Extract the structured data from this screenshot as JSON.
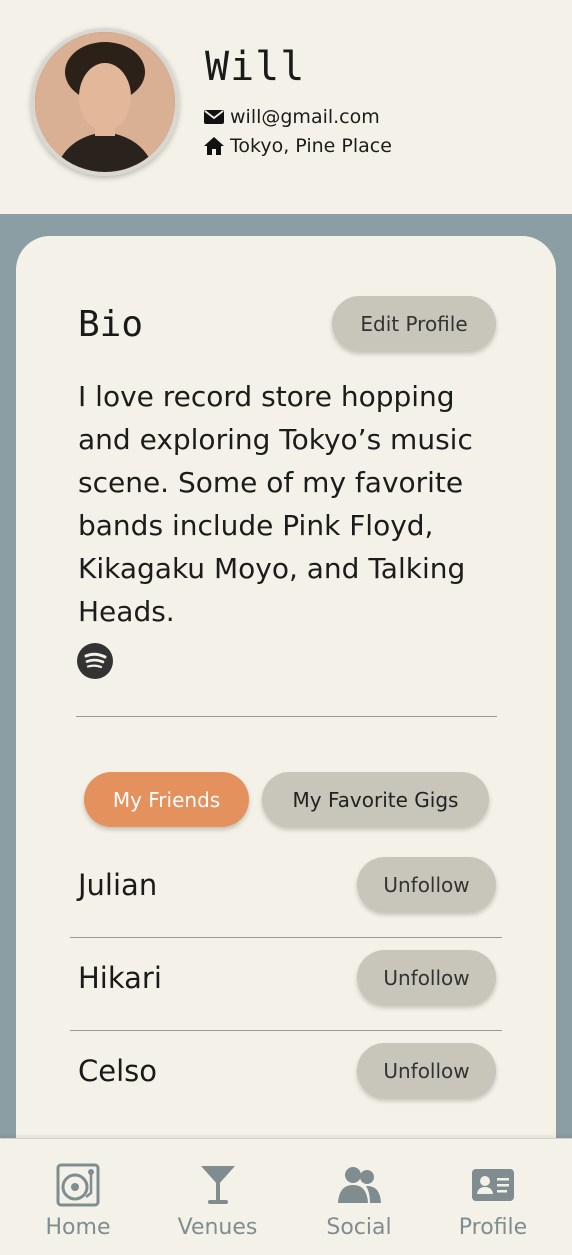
{
  "user": {
    "name": "Will",
    "email": "will@gmail.com",
    "location": "Tokyo, Pine Place"
  },
  "bio": {
    "title": "Bio",
    "edit_label": "Edit Profile",
    "text": "I love record store hopping and exploring Tokyo’s music scene. Some of my favorite bands include Pink Floyd, Kikagaku Moyo, and Talking Heads."
  },
  "tabs": {
    "friends": "My Friends",
    "gigs": "My Favorite Gigs"
  },
  "friends": [
    {
      "name": "Julian",
      "action": "Unfollow"
    },
    {
      "name": "Hikari",
      "action": "Unfollow"
    },
    {
      "name": "Celso",
      "action": "Unfollow"
    }
  ],
  "nav": {
    "home": "Home",
    "venues": "Venues",
    "social": "Social",
    "profile": "Profile"
  },
  "colors": {
    "accent": "#e4915e",
    "background": "#f4f2e8",
    "main_bg": "#8a9ea3",
    "button": "#c8c5bb",
    "nav_icon": "#7f8d90"
  },
  "icons": {
    "email": "envelope-icon",
    "location": "home-icon",
    "music": "spotify-icon"
  }
}
